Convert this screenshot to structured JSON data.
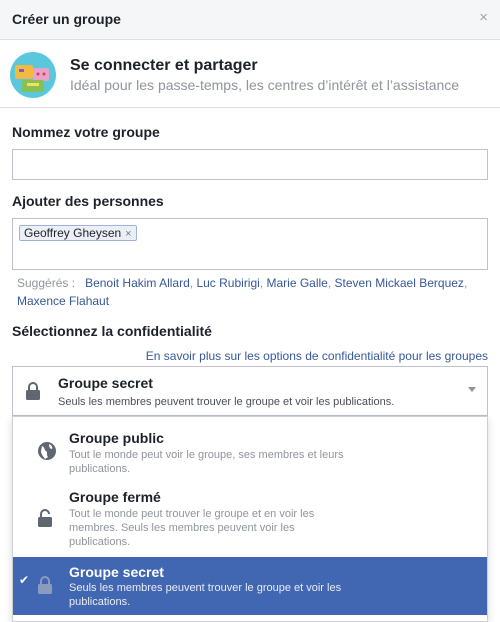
{
  "header": {
    "title": "Créer un groupe",
    "close": "×"
  },
  "intro": {
    "title": "Se connecter et partager",
    "subtitle": "Idéal pour les passe-temps, les centres d’intérêt et l’assistance"
  },
  "name_field": {
    "label": "Nommez votre groupe",
    "value": ""
  },
  "people_field": {
    "label": "Ajouter des personnes",
    "chips": [
      {
        "label": "Geoffrey Gheysen",
        "remove": "×"
      }
    ]
  },
  "suggestions": {
    "prefix": "Suggérés :",
    "names": [
      "Benoit Hakim Allard",
      "Luc Rubirigi",
      "Marie Galle",
      "Steven Mickael Berquez",
      "Maxence Flahaut"
    ]
  },
  "privacy": {
    "label": "Sélectionnez la confidentialité",
    "learn_more": "En savoir plus sur les options de confidentialité pour les groupes",
    "selected": {
      "title": "Groupe secret",
      "description": "Seuls les membres peuvent trouver le groupe et voir les publications.",
      "icon": "lock-icon"
    },
    "options": [
      {
        "title": "Groupe public",
        "description_lines": [
          "Tout le monde peut voir le groupe, ses membres et leurs",
          "publications."
        ],
        "icon": "globe-icon",
        "selected": false
      },
      {
        "title": "Groupe fermé",
        "description_lines": [
          "Tout le monde peut trouver le groupe et en voir les",
          "membres. Seuls les membres peuvent voir les",
          "publications."
        ],
        "icon": "lock-icon",
        "selected": false
      },
      {
        "title": "Groupe secret",
        "description_lines": [
          "Seuls les membres peuvent trouver le groupe et voir les",
          "publications."
        ],
        "icon": "lock-icon",
        "selected": true,
        "check": "✔"
      }
    ]
  },
  "colors": {
    "accent": "#4267b2",
    "link": "#365899",
    "muted": "#90949c"
  }
}
